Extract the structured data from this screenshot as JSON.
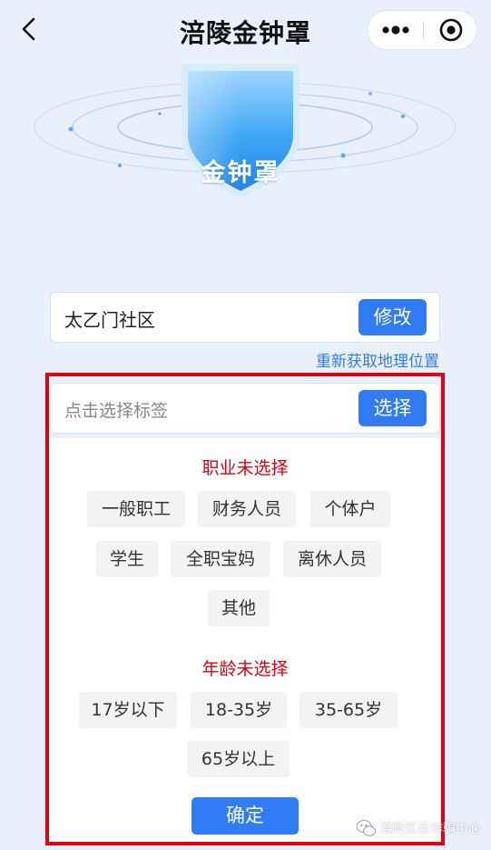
{
  "header": {
    "title": "涪陵金钟罩",
    "back_icon": "chevron-left-icon",
    "more_icon": "more-dots-icon",
    "close_icon": "target-close-icon"
  },
  "hero": {
    "shield_text": "金钟罩",
    "shield_icon": "shield-icon"
  },
  "location": {
    "value": "太乙门社区",
    "modify_label": "修改",
    "refetch_label": "重新获取地理位置"
  },
  "tags": {
    "placeholder": "点击选择标签",
    "select_label": "选择"
  },
  "occupation": {
    "title": "职业未选择",
    "options": [
      "一般职工",
      "财务人员",
      "个体户",
      "学生",
      "全职宝妈",
      "离休人员",
      "其他"
    ]
  },
  "age": {
    "title": "年龄未选择",
    "options": [
      "17岁以下",
      "18-35岁",
      "35-65岁",
      "65岁以上"
    ]
  },
  "confirm_label": "确定",
  "watermark": "涪陵区反诈骗中心",
  "colors": {
    "accent": "#2f7cf6",
    "warning": "#e00012",
    "background": "#e9f0fb"
  }
}
